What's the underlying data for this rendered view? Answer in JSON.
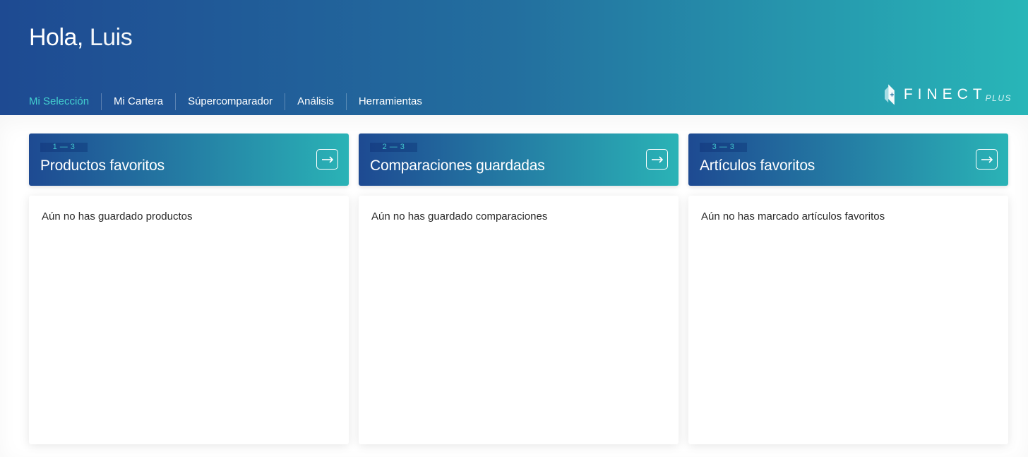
{
  "header": {
    "greeting": "Hola,",
    "user_name": "Luis",
    "nav": [
      {
        "label": "Mi Selección",
        "active": true
      },
      {
        "label": "Mi Cartera",
        "active": false
      },
      {
        "label": "Súpercomparador",
        "active": false
      },
      {
        "label": "Análisis",
        "active": false
      },
      {
        "label": "Herramientas",
        "active": false
      }
    ],
    "logo": {
      "text": "FINECT",
      "suffix": "PLUS"
    }
  },
  "cards": [
    {
      "step": "1 — 3",
      "title": "Productos favoritos",
      "empty_message": "Aún no has guardado productos"
    },
    {
      "step": "2 — 3",
      "title": "Comparaciones guardadas",
      "empty_message": "Aún no has guardado comparaciones"
    },
    {
      "step": "3 — 3",
      "title": "Artículos favoritos",
      "empty_message": "Aún no has marcado artículos favoritos"
    }
  ],
  "colors": {
    "gradient_start": "#1e4a92",
    "gradient_end": "#28b6b8",
    "active_nav": "#43d0cf",
    "step_text": "#40c4cc"
  }
}
